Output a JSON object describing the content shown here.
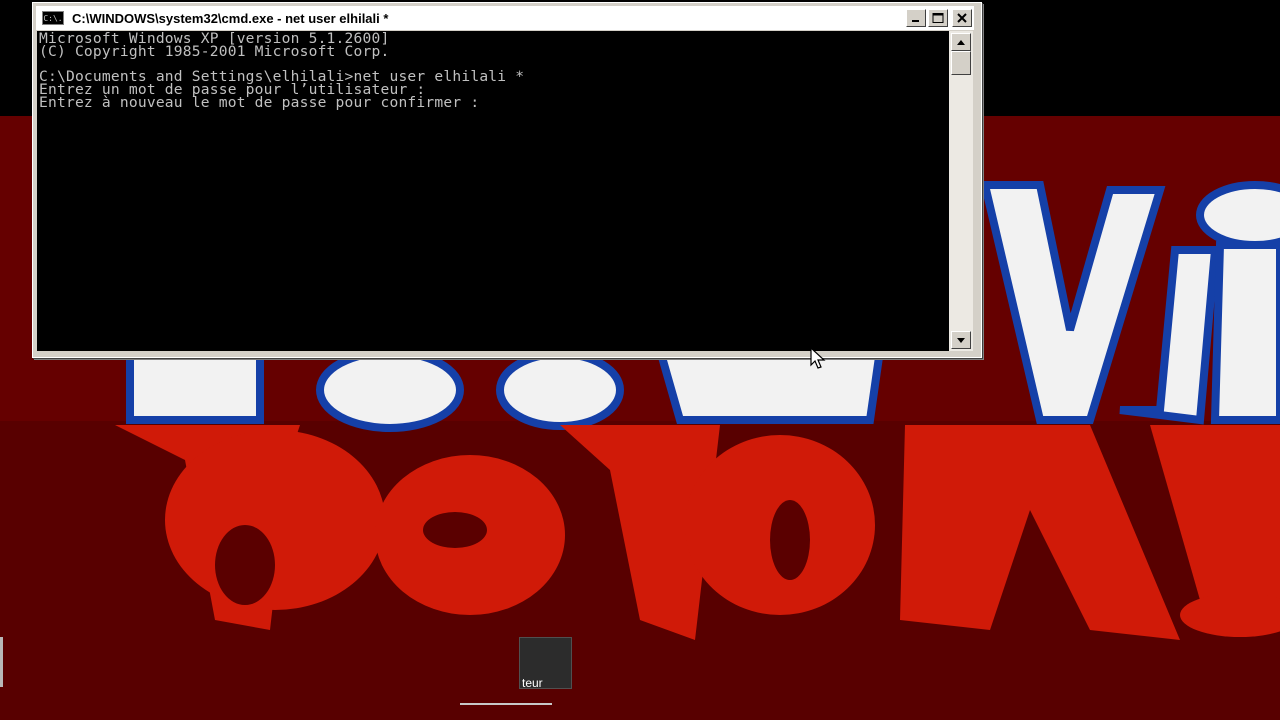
{
  "window": {
    "title": "C:\\WINDOWS\\system32\\cmd.exe - net user elhilali *",
    "icon": "cmd-icon",
    "icon_text": "C:\\.",
    "controls": [
      "minimize-icon",
      "maximize-icon",
      "close-icon"
    ]
  },
  "console": {
    "lines": [
      "Microsoft Windows XP [version 5.1.2600]",
      "(C) Copyright 1985-2001 Microsoft Corp.",
      "",
      "C:\\Documents and Settings\\elhilali>net user elhilali *",
      "Entrez un mot de passe pour l’utilisateur :",
      "Entrez à nouveau le mot de passe pour confirmer :"
    ]
  },
  "taskbar": {
    "tile_label": "teur"
  },
  "colors": {
    "console_bg": "#000000",
    "console_text": "#c0c0c0",
    "wallpaper_red": "#d01a08",
    "wallpaper_dark": "#580000",
    "logo_white": "#f2f2f2",
    "logo_blue": "#1540a8"
  }
}
